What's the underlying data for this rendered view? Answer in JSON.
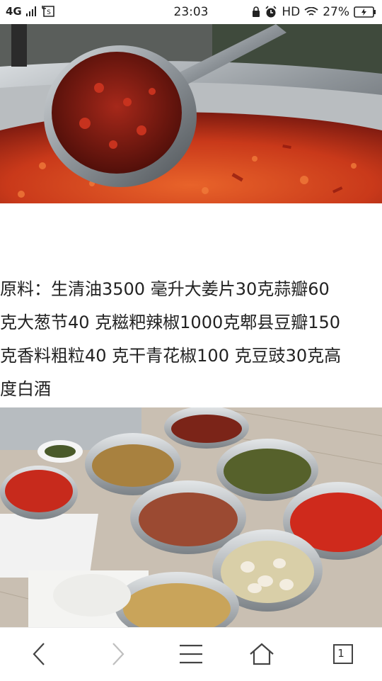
{
  "status_bar": {
    "network": "4G",
    "time": "23:03",
    "hd": "HD",
    "battery": "27%"
  },
  "article": {
    "lines": [
      "  原料：生清油3500 毫升大姜片30克蒜瓣60",
      "克大葱节40 克糍粑辣椒1000克郫县豆瓣150",
      "克香料粗粒40 克干青花椒100 克豆豉30克高",
      "度白酒"
    ]
  },
  "bottom_nav": {
    "tab_count": "1"
  },
  "icons": {
    "back": "back-icon",
    "forward": "forward-icon",
    "menu": "menu-icon",
    "home": "home-icon",
    "tabs": "tabs-icon"
  },
  "colors": {
    "chili_red": "#c6301a",
    "oil_orange": "#d9541f",
    "steel": "#9aa0a6",
    "disabled_gray": "#bfbfbf"
  }
}
